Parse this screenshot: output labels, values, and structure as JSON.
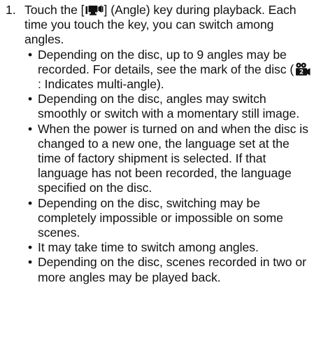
{
  "step": {
    "number": "1.",
    "text_before_icon": "Touch the [",
    "key_icon": "angle-key-icon",
    "text_after_icon": "] (Angle) key during playback. Each time you touch the key, you can switch among angles."
  },
  "notes": [
    {
      "text_before_icon": "Depending on the disc, up to 9 angles may be recorded. For details, see the mark of the disc (",
      "icon": "multi-angle-mark-icon",
      "text_after_icon": ": Indicates multi-angle)."
    },
    {
      "text": "Depending on the disc, angles may switch smoothly or switch with a momentary still image."
    },
    {
      "text": "When the power is turned on and when the disc is changed to a new one, the language set at the time of factory shipment is selected. If that language has not been recorded, the language specified on the disc."
    },
    {
      "text": "Depending on the disc, switching may be completely impossible or impossible on some scenes."
    },
    {
      "text": "It may take time to switch among angles."
    },
    {
      "text": "Depending on the disc, scenes recorded in two or more angles may be played back."
    }
  ],
  "bullet_char": "•",
  "colors": {
    "text": "#111111",
    "background": "#ffffff"
  }
}
